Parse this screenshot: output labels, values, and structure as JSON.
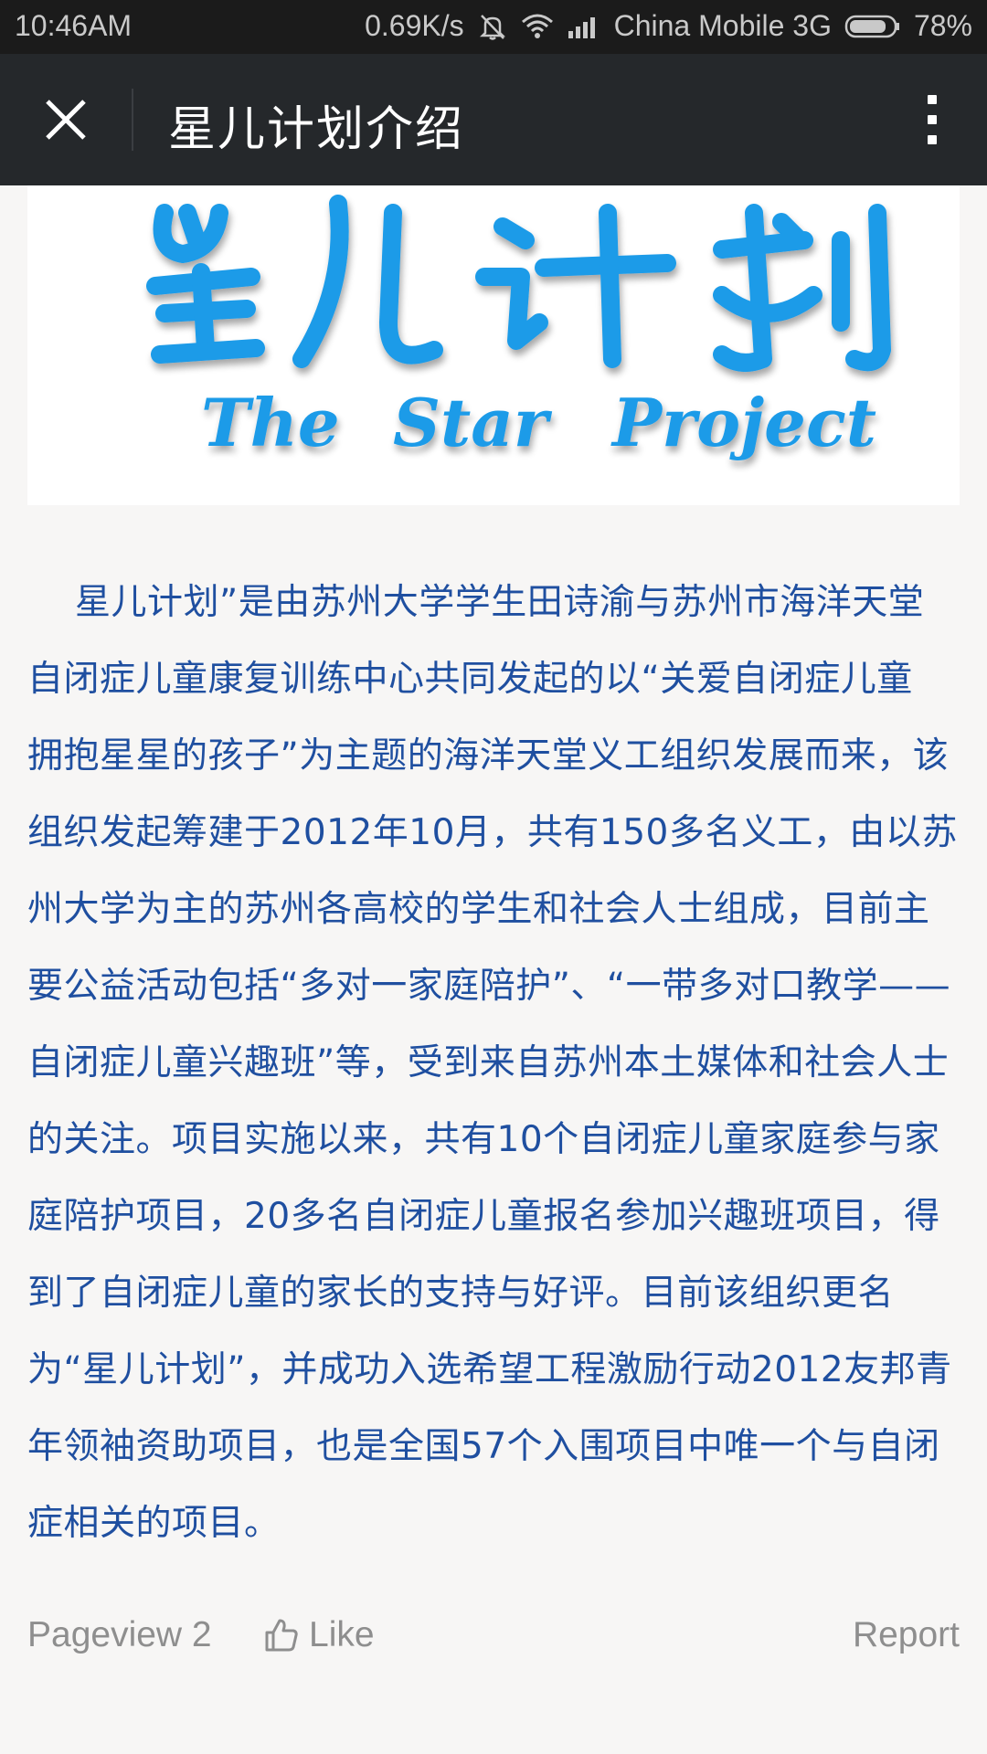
{
  "status_bar": {
    "time": "10:46AM",
    "speed": "0.69K/s",
    "carrier": "China Mobile 3G",
    "battery": "78%",
    "icons": [
      "mute-icon",
      "wifi-icon",
      "signal-icon",
      "battery-icon"
    ]
  },
  "header": {
    "title": "星儿计划介绍",
    "close_icon": "close-icon",
    "more_icon": "more-vertical-icon"
  },
  "banner": {
    "logo_cn": "星儿计划",
    "logo_en": "The  Star  Project",
    "color": "#1e9be8"
  },
  "article": {
    "body": "星儿计划”是由苏州大学学生田诗渝与苏州市海洋天堂自闭症儿童康复训练中心共同发起的以“关爱自闭症儿童 拥抱星星的孩子”为主题的海洋天堂义工组织发展而来，该组织发起筹建于2012年10月，共有150多名义工，由以苏州大学为主的苏州各高校的学生和社会人士组成，目前主要公益活动包括“多对一家庭陪护”、“一带多对口教学——自闭症儿童兴趣班”等，受到来自苏州本土媒体和社会人士的关注。项目实施以来，共有10个自闭症儿童家庭参与家庭陪护项目，20多名自闭症儿童报名参加兴趣班项目，得到了自闭症儿童的家长的支持与好评。目前该组织更名为“星儿计划”，并成功入选希望工程激励行动2012友邦青年领袖资助项目，也是全国57个入围项目中唯一个与自闭症相关的项目。",
    "text_color": "#1f4fa0"
  },
  "footer": {
    "pageview": "Pageview 2",
    "like": "Like",
    "report": "Report"
  }
}
